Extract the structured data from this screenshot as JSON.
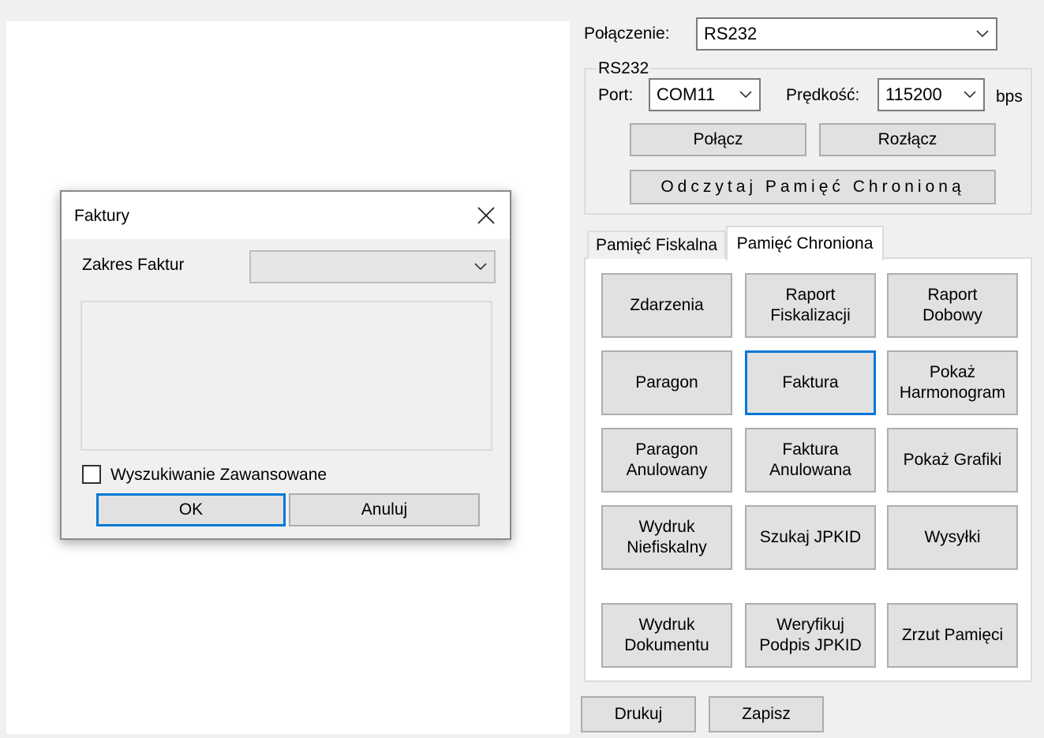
{
  "connection": {
    "label": "Połączenie:",
    "selected": "RS232"
  },
  "rs232": {
    "group_title": "RS232",
    "port_label": "Port:",
    "port_value": "COM11",
    "speed_label": "Prędkość:",
    "speed_value": "115200",
    "speed_unit": "bps",
    "connect_button": "Połącz",
    "disconnect_button": "Rozłącz",
    "read_memory_button": "Odczytaj Pamięć Chronioną"
  },
  "tabs": [
    {
      "label": "Pamięć Fiskalna",
      "active": false
    },
    {
      "label": "Pamięć Chroniona",
      "active": true
    }
  ],
  "grid_buttons": [
    "Zdarzenia",
    "Raport\nFiskalizacji",
    "Raport\nDobowy",
    "Paragon",
    "Faktura",
    "Pokaż\nHarmonogram",
    "Paragon\nAnulowany",
    "Faktura\nAnulowana",
    "Pokaż Grafiki",
    "Wydruk\nNiefiskalny",
    "Szukaj JPKID",
    "Wysyłki",
    "Wydruk\nDokumentu",
    "Weryfikuj\nPodpis JPKID",
    "Zrzut Pamięci"
  ],
  "bottom": {
    "print_button": "Drukuj",
    "save_button": "Zapisz"
  },
  "dialog": {
    "title": "Faktury",
    "range_label": "Zakres Faktur",
    "range_value": "",
    "advanced_search_label": "Wyszukiwanie Zawansowane",
    "advanced_search_checked": false,
    "ok_button": "OK",
    "cancel_button": "Anuluj"
  },
  "colors": {
    "focus_border": "#0078d7",
    "button_face": "#e1e1e1",
    "window_bg": "#f0f0f0"
  }
}
